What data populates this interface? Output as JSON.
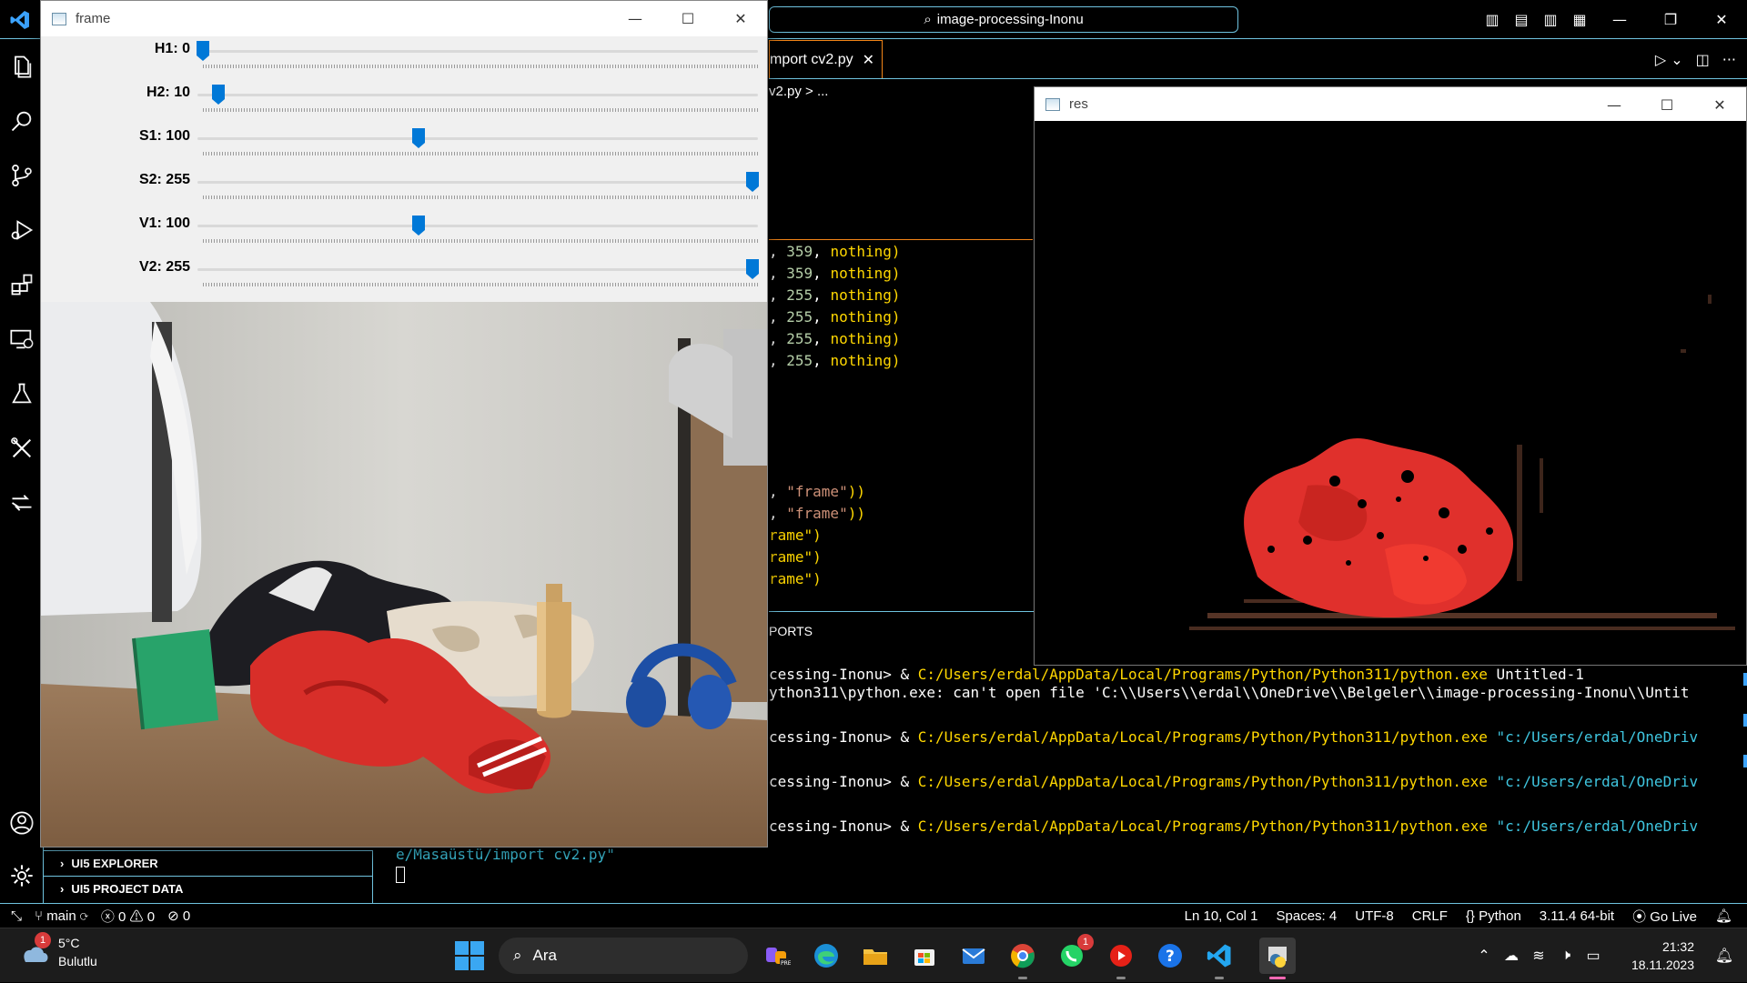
{
  "vscode": {
    "command_center": "image-processing-Inonu",
    "tab_label": "mport cv2.py",
    "breadcrumb": "v2.py > ...",
    "code_lines": [
      [
        ", ",
        "359",
        ", ",
        "nothing",
        ")"
      ],
      [
        ", ",
        "359",
        ", ",
        "nothing",
        ")"
      ],
      [
        ", ",
        "255",
        ", ",
        "nothing",
        ")"
      ],
      [
        ", ",
        "255",
        ", ",
        "nothing",
        ")"
      ],
      [
        ", ",
        "255",
        ", ",
        "nothing",
        ")"
      ],
      [
        ", ",
        "255",
        ", ",
        "nothing",
        ")"
      ]
    ],
    "code_lines2": [
      ", \"frame\"))",
      ", \"frame\"))",
      "rame\")",
      "rame\")",
      "rame\")"
    ],
    "panel_tab": "PORTS",
    "terminal": [
      {
        "prefix": "cessing-Inonu> & ",
        "cmd": "C:/Users/erdal/AppData/Local/Programs/Python/Python311/python.exe",
        "arg": " Untitled-1",
        "arg_color": "w"
      },
      {
        "prefix": "ython311\\python.exe: can't open file 'C:\\\\Users\\\\erdal\\\\OneDrive\\\\Belgeler\\\\image-processing-Inonu\\\\Untit",
        "cmd": "",
        "arg": "",
        "arg_color": "w"
      },
      {
        "prefix": "cessing-Inonu> & ",
        "cmd": "C:/Users/erdal/AppData/Local/Programs/Python/Python311/python.exe",
        "arg": " \"c:/Users/erdal/OneDriv",
        "arg_color": "c"
      },
      {
        "prefix": "cessing-Inonu> & ",
        "cmd": "C:/Users/erdal/AppData/Local/Programs/Python/Python311/python.exe",
        "arg": " \"c:/Users/erdal/OneDriv",
        "arg_color": "c"
      },
      {
        "prefix": "cessing-Inonu> & ",
        "cmd": "C:/Users/erdal/AppData/Local/Programs/Python/Python311/python.exe",
        "arg": " \"c:/Users/erdal/OneDriv",
        "arg_color": "c"
      }
    ],
    "terminal_tail": "e/Masaüstü/import cv2.py\"",
    "sidebar_sections": [
      "UI5 EXPLORER",
      "UI5 PROJECT DATA"
    ],
    "status": {
      "branch": "main",
      "errors": "0",
      "warnings": "0",
      "ports": "0",
      "position": "Ln 10, Col 1",
      "spaces": "Spaces: 4",
      "encoding": "UTF-8",
      "eol": "CRLF",
      "language": "Python",
      "interpreter": "3.11.4 64-bit",
      "golive": "Go Live"
    }
  },
  "frame_window": {
    "title": "frame",
    "trackbars": [
      {
        "label": "H1: 0",
        "value": 0,
        "max": 359
      },
      {
        "label": "H2: 10",
        "value": 10,
        "max": 359
      },
      {
        "label": "S1: 100",
        "value": 100,
        "max": 255
      },
      {
        "label": "S2: 255",
        "value": 255,
        "max": 255
      },
      {
        "label": "V1: 100",
        "value": 100,
        "max": 255
      },
      {
        "label": "V2: 255",
        "value": 255,
        "max": 255
      }
    ]
  },
  "res_window": {
    "title": "res"
  },
  "taskbar": {
    "weather_temp": "5°C",
    "weather_desc": "Bulutlu",
    "weather_badge": "1",
    "search_placeholder": "Ara",
    "whatsapp_badge": "1",
    "time": "21:32",
    "date": "18.11.2023"
  },
  "colors": {
    "accent_border": "#6fc3df",
    "active_tab": "#f38518",
    "thumb": "#0078d7",
    "jacket_red": "#e0302c"
  }
}
